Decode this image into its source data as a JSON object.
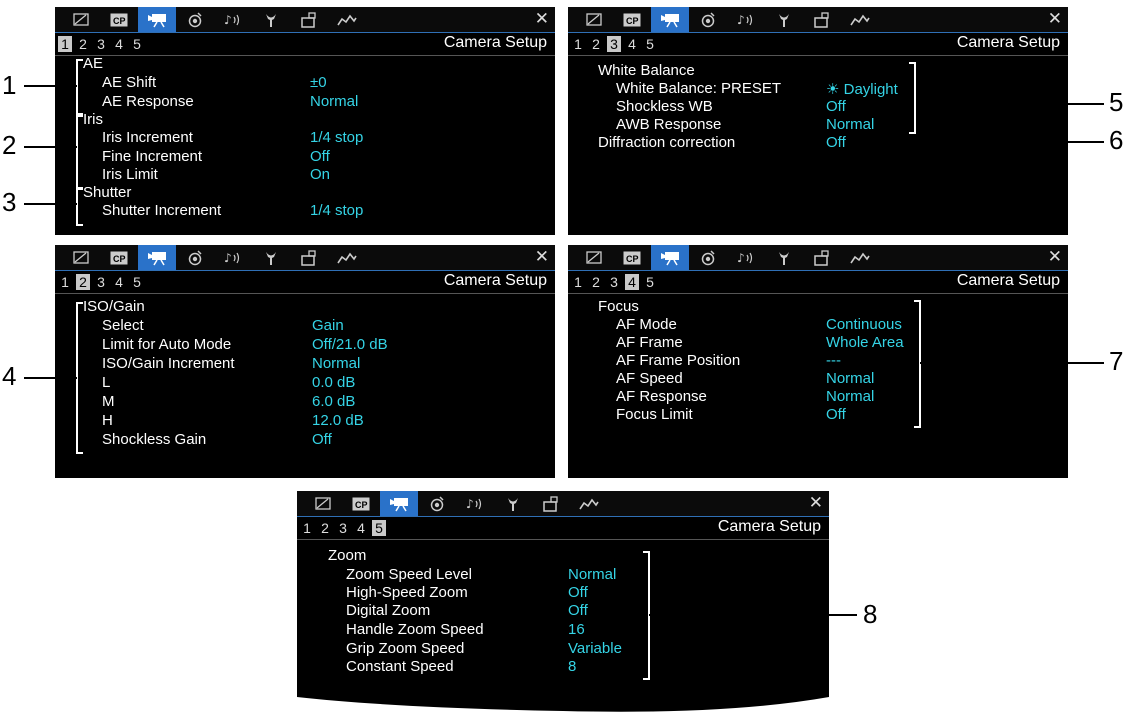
{
  "common": {
    "close_symbol": "✕",
    "header_title": "Camera Setup",
    "pages": [
      "1",
      "2",
      "3",
      "4",
      "5"
    ],
    "tabs": [
      "edit-icon",
      "cp-icon",
      "camera-icon",
      "recording-icon",
      "audio-icon",
      "wrench-icon",
      "my-menu-icon",
      "waveform-icon"
    ],
    "colors": {
      "value": "#35d4e6",
      "active_tab": "#2a72c9",
      "background": "#000000"
    }
  },
  "panel1": {
    "active_page": "1",
    "ae": "AE",
    "ae_shift": "AE Shift",
    "ae_shift_value": "±0",
    "ae_response": "AE Response",
    "ae_response_value": "Normal",
    "iris": "Iris",
    "iris_increment": "Iris Increment",
    "iris_increment_value": "1/4 stop",
    "fine_increment": "Fine Increment",
    "fine_increment_value": "Off",
    "iris_limit": "Iris Limit",
    "iris_limit_value": "On",
    "shutter": "Shutter",
    "shutter_increment": "Shutter Increment",
    "shutter_increment_value": "1/4 stop"
  },
  "panel2": {
    "active_page": "3",
    "white_balance": "White Balance",
    "wb_preset": "White Balance: PRESET",
    "wb_preset_value": "☀ Daylight",
    "shockless_wb": "Shockless WB",
    "shockless_wb_value": "Off",
    "awb_response": "AWB Response",
    "awb_response_value": "Normal",
    "diffraction": "Diffraction correction",
    "diffraction_value": "Off"
  },
  "panel3": {
    "active_page": "2",
    "iso_gain": "ISO/Gain",
    "select": "Select",
    "select_value": "Gain",
    "limit_auto": "Limit for Auto Mode",
    "limit_auto_value": "Off/21.0 dB",
    "iso_increment": "ISO/Gain Increment",
    "iso_increment_value": "Normal",
    "l": "L",
    "l_value": "0.0 dB",
    "m": "M",
    "m_value": "6.0 dB",
    "h": "H",
    "h_value": "12.0 dB",
    "shockless_gain": "Shockless Gain",
    "shockless_gain_value": "Off"
  },
  "panel4": {
    "active_page": "4",
    "focus": "Focus",
    "af_mode": "AF Mode",
    "af_mode_value": "Continuous",
    "af_frame": "AF Frame",
    "af_frame_value": "Whole Area",
    "af_frame_position": "AF Frame Position",
    "af_frame_position_value": "---",
    "af_speed": "AF Speed",
    "af_speed_value": "Normal",
    "af_response": "AF Response",
    "af_response_value": "Normal",
    "focus_limit": "Focus Limit",
    "focus_limit_value": "Off"
  },
  "panel5": {
    "active_page": "5",
    "zoom": "Zoom",
    "zoom_speed_level": "Zoom Speed Level",
    "zoom_speed_level_value": "Normal",
    "high_speed_zoom": "High-Speed Zoom",
    "high_speed_zoom_value": "Off",
    "digital_zoom": "Digital Zoom",
    "digital_zoom_value": "Off",
    "handle_zoom_speed": "Handle Zoom Speed",
    "handle_zoom_speed_value": "16",
    "grip_zoom_speed": "Grip Zoom Speed",
    "grip_zoom_speed_value": "Variable",
    "constant_speed": "Constant Speed",
    "constant_speed_value": "8"
  },
  "callouts": [
    "1",
    "2",
    "3",
    "4",
    "5",
    "6",
    "7",
    "8"
  ]
}
